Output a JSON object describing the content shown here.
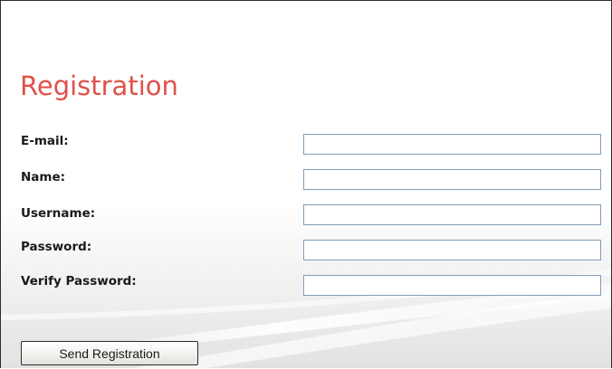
{
  "form": {
    "title": "Registration",
    "fields": [
      {
        "label": "E-mail:",
        "value": "",
        "type": "text"
      },
      {
        "label": "Name:",
        "value": "",
        "type": "text"
      },
      {
        "label": "Username:",
        "value": "",
        "type": "text"
      },
      {
        "label": "Password:",
        "value": "",
        "type": "password"
      },
      {
        "label": "Verify Password:",
        "value": "",
        "type": "password"
      }
    ],
    "submit_label": "Send Registration"
  },
  "colors": {
    "title": "#e0514a",
    "input_border": "#7f9db9",
    "background": "#ffffff"
  }
}
